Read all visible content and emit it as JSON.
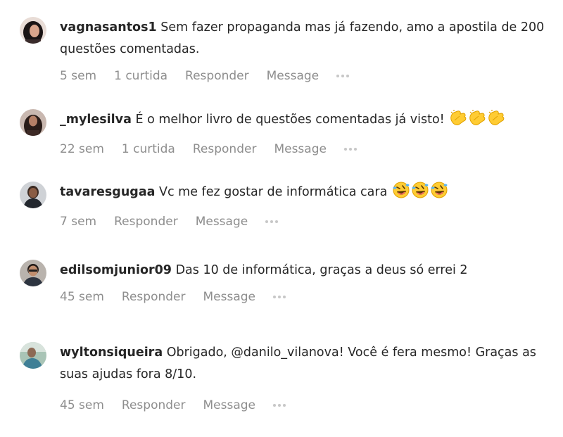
{
  "comments": [
    {
      "username": "vagnasantos1",
      "text": "Sem fazer propaganda mas já fazendo, amo a apostila de 200 questões comentadas.",
      "time": "5 sem",
      "likes": "1 curtida",
      "reply_label": "Responder",
      "message_label": "Message",
      "emoji": []
    },
    {
      "username": "_mylesilva",
      "text": "É o melhor livro de questões comentadas já visto! ",
      "time": "22 sem",
      "likes": "1 curtida",
      "reply_label": "Responder",
      "message_label": "Message",
      "emoji": [
        "clapping-hands-emoji",
        "clapping-hands-emoji",
        "clapping-hands-emoji"
      ]
    },
    {
      "username": "tavaresgugaa",
      "text": "Vc me fez gostar de informática cara ",
      "time": "7 sem",
      "reply_label": "Responder",
      "message_label": "Message",
      "emoji": [
        "rolling-laughing-emoji",
        "rolling-laughing-emoji",
        "rolling-laughing-emoji"
      ]
    },
    {
      "username": "edilsomjunior09",
      "text": "Das 10 de informática, graças a deus só errei 2",
      "time": "45 sem",
      "reply_label": "Responder",
      "message_label": "Message",
      "emoji": []
    },
    {
      "username": "wyltonsiqueira",
      "text": "Obrigado, @danilo_vilanova! Você é fera mesmo! Graças as suas ajudas fora 8/10.",
      "time": "45 sem",
      "reply_label": "Responder",
      "message_label": "Message",
      "emoji": []
    }
  ],
  "icons": {
    "more": "more-options-icon",
    "clap": "clapping-hands-emoji",
    "laugh": "rolling-laughing-emoji"
  },
  "colors": {
    "text": "#262626",
    "meta": "#8e8e8e",
    "dots": "#c7c7c7",
    "emoji_yellow": "#ffcc33"
  }
}
